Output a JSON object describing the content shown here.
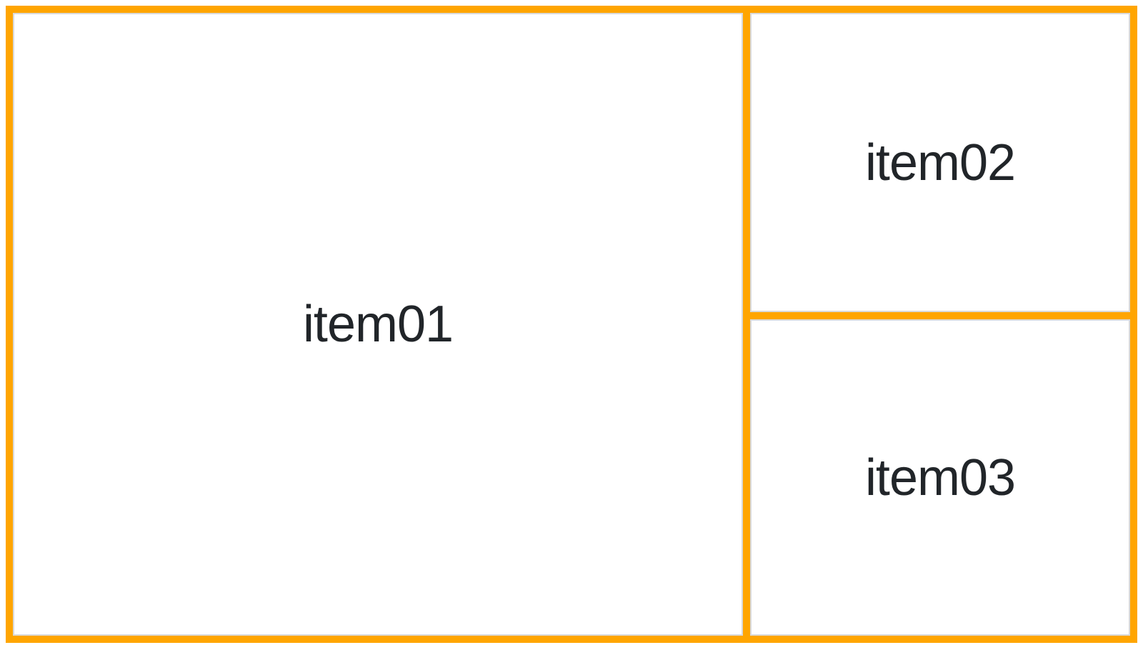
{
  "colors": {
    "accent": "#FFA500",
    "item_background": "#FFFFFF",
    "item_border": "#D9D9D9",
    "text": "#212529"
  },
  "grid": {
    "items": [
      {
        "label": "item01"
      },
      {
        "label": "item02"
      },
      {
        "label": "item03"
      }
    ]
  }
}
